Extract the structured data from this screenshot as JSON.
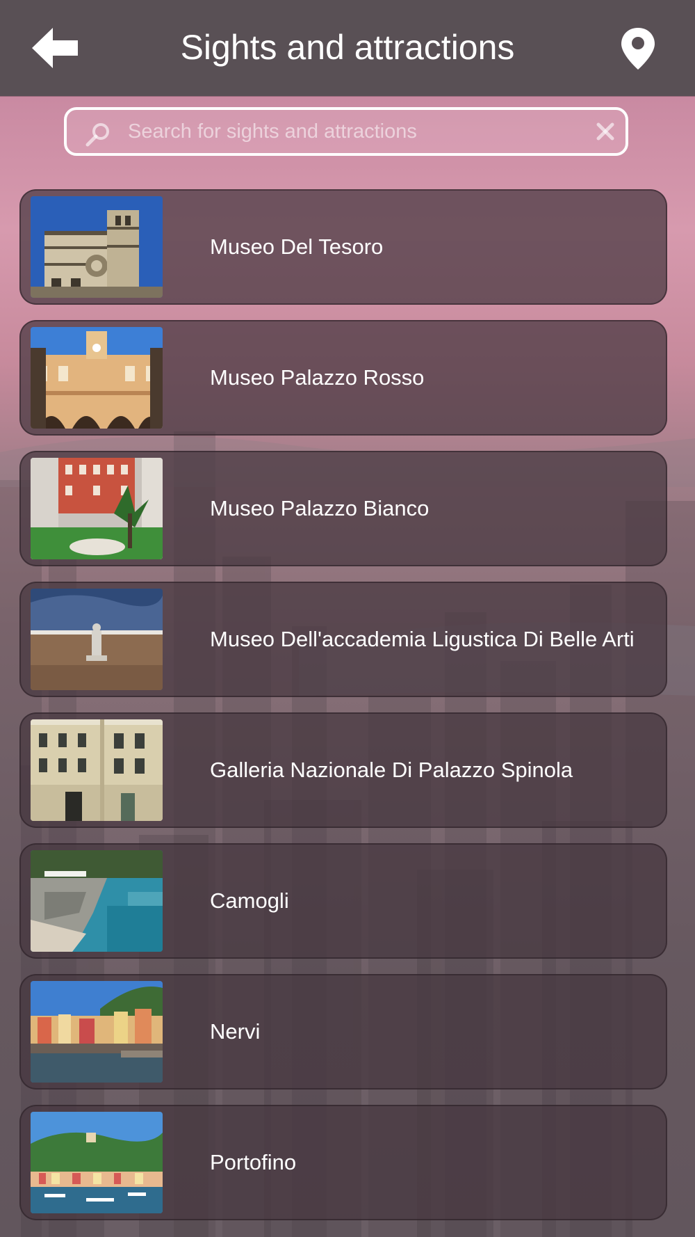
{
  "header": {
    "title": "Sights and attractions",
    "back_icon": "arrow-left-icon",
    "map_icon": "map-pin-icon"
  },
  "search": {
    "placeholder": "Search for sights and attractions",
    "value": "",
    "icon": "search-icon",
    "clear_icon": "clear-icon"
  },
  "attractions": [
    {
      "name": "Museo Del Tesoro",
      "thumb": "cathedral-photo"
    },
    {
      "name": "Museo Palazzo Rosso",
      "thumb": "palazzo-courtyard-photo"
    },
    {
      "name": "Museo Palazzo Bianco",
      "thumb": "palazzo-garden-photo"
    },
    {
      "name": "Museo Dell'accademia Ligustica Di Belle Arti",
      "thumb": "statue-photo"
    },
    {
      "name": "Galleria Nazionale Di Palazzo Spinola",
      "thumb": "palazzo-facade-photo"
    },
    {
      "name": "Camogli",
      "thumb": "beach-photo"
    },
    {
      "name": "Nervi",
      "thumb": "harbor-photo"
    },
    {
      "name": "Portofino",
      "thumb": "portofino-photo"
    }
  ],
  "colors": {
    "topbar": "#595055",
    "card": "#463840",
    "text": "#ffffff"
  }
}
